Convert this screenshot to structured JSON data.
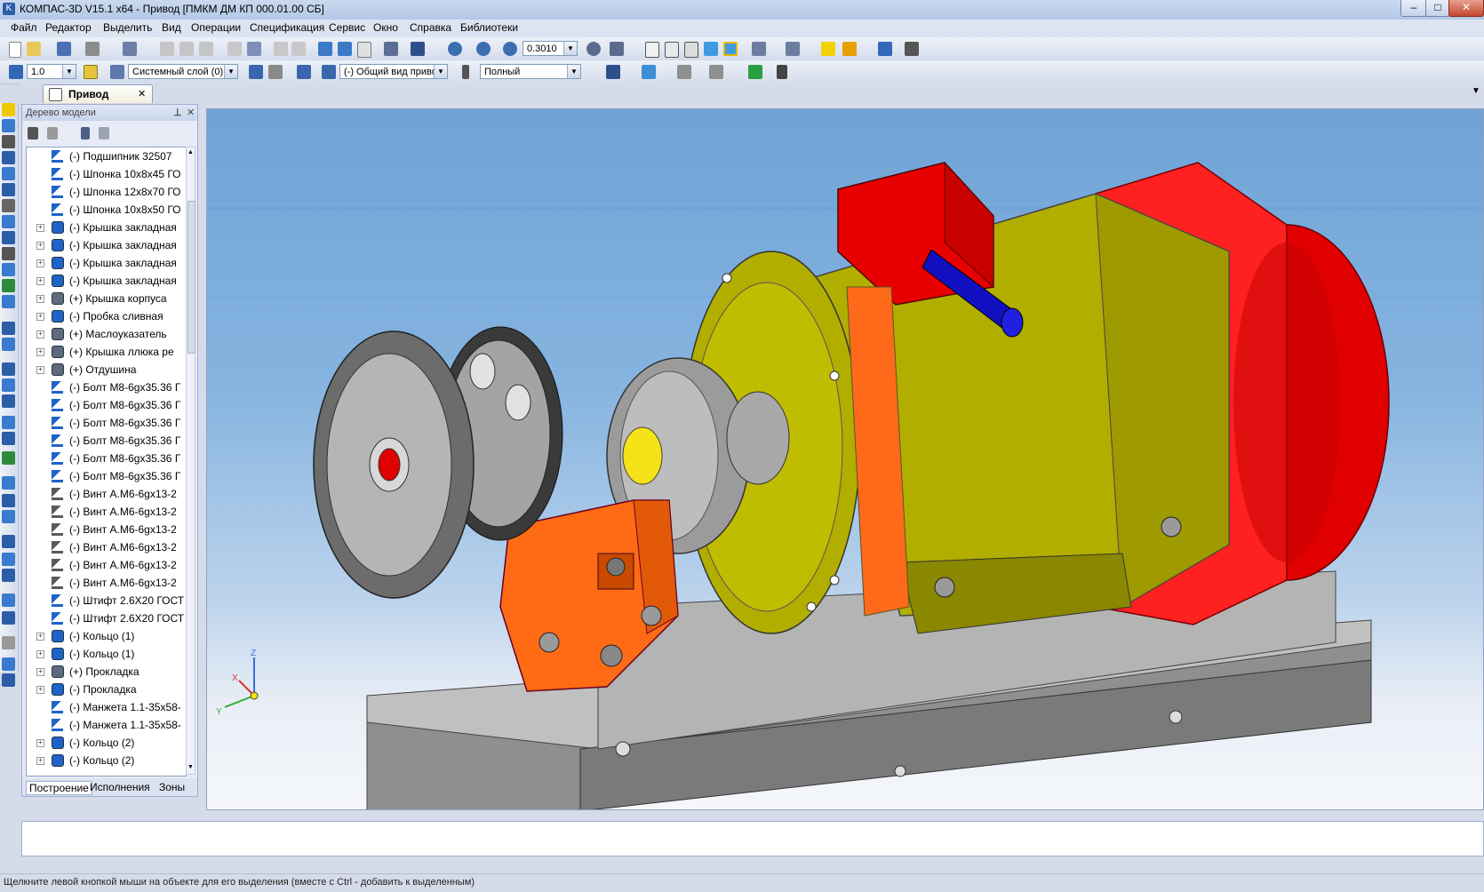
{
  "window": {
    "title": "КОМПАС-3D V15.1 x64 - Привод [ПМКМ ДМ КП 000.01.00 СБ]",
    "minimize": "–",
    "maximize": "□",
    "close": "✕"
  },
  "menu": {
    "items": [
      "Файл",
      "Редактор",
      "Выделить",
      "Вид",
      "Операции",
      "Спецификация",
      "Сервис",
      "Окно",
      "Справка",
      "Библиотеки"
    ]
  },
  "toolbar1": {
    "zoom_value": "0.3010"
  },
  "toolbar2": {
    "step_value": "1.0",
    "layer_value": "Системный слой (0)",
    "view_value": "(-) Общий вид приво",
    "render_value": "Полный"
  },
  "document_tab": {
    "label": "Привод",
    "close": "✕"
  },
  "model_tree": {
    "header": "Дерево модели",
    "pin": "⊥",
    "close": "✕",
    "items": [
      {
        "label": "(-) Подшипник 32507",
        "expandable": false,
        "icon": "part"
      },
      {
        "label": "(-) Шпонка 10x8x45 ГО",
        "expandable": false,
        "icon": "part"
      },
      {
        "label": "(-) Шпонка 12x8x70 ГО",
        "expandable": false,
        "icon": "part"
      },
      {
        "label": "(-) Шпонка 10x8x50 ГО",
        "expandable": false,
        "icon": "part"
      },
      {
        "label": "(-) Крышка закладная",
        "expandable": true,
        "icon": "assembly"
      },
      {
        "label": "(-) Крышка закладная",
        "expandable": true,
        "icon": "assembly"
      },
      {
        "label": "(-) Крышка закладная",
        "expandable": true,
        "icon": "assembly"
      },
      {
        "label": "(-) Крышка закладная",
        "expandable": true,
        "icon": "assembly"
      },
      {
        "label": "(+) Крышка корпуса",
        "expandable": true,
        "icon": "assembly-fixed"
      },
      {
        "label": "(-) Пробка сливная",
        "expandable": true,
        "icon": "assembly"
      },
      {
        "label": "(+) Маслоуказатель",
        "expandable": true,
        "icon": "assembly-fixed"
      },
      {
        "label": "(+) Крышка ллюка ре",
        "expandable": true,
        "icon": "assembly-fixed"
      },
      {
        "label": "(+) Отдушина",
        "expandable": true,
        "icon": "assembly-fixed"
      },
      {
        "label": "(-) Болт М8-6gx35.36 Г",
        "expandable": false,
        "icon": "part"
      },
      {
        "label": "(-) Болт М8-6gx35.36 Г",
        "expandable": false,
        "icon": "part"
      },
      {
        "label": "(-) Болт М8-6gx35.36 Г",
        "expandable": false,
        "icon": "part"
      },
      {
        "label": "(-) Болт М8-6gx35.36 Г",
        "expandable": false,
        "icon": "part"
      },
      {
        "label": "(-) Болт М8-6gx35.36 Г",
        "expandable": false,
        "icon": "part"
      },
      {
        "label": "(-) Болт М8-6gx35.36 Г",
        "expandable": false,
        "icon": "part"
      },
      {
        "label": "(-) Винт А.М6-6gx13-2",
        "expandable": false,
        "icon": "part-gray"
      },
      {
        "label": "(-) Винт А.М6-6gx13-2",
        "expandable": false,
        "icon": "part-gray"
      },
      {
        "label": "(-) Винт А.М6-6gx13-2",
        "expandable": false,
        "icon": "part-gray"
      },
      {
        "label": "(-) Винт А.М6-6gx13-2",
        "expandable": false,
        "icon": "part-gray"
      },
      {
        "label": "(-) Винт А.М6-6gx13-2",
        "expandable": false,
        "icon": "part-gray"
      },
      {
        "label": "(-) Винт А.М6-6gx13-2",
        "expandable": false,
        "icon": "part-gray"
      },
      {
        "label": "(-) Штифт 2.6X20 ГОСТ",
        "expandable": false,
        "icon": "part"
      },
      {
        "label": "(-) Штифт 2.6X20 ГОСТ",
        "expandable": false,
        "icon": "part"
      },
      {
        "label": "(-) Кольцо (1)",
        "expandable": true,
        "icon": "assembly"
      },
      {
        "label": "(-) Кольцо (1)",
        "expandable": true,
        "icon": "assembly"
      },
      {
        "label": "(+) Прокладка",
        "expandable": true,
        "icon": "assembly-fixed"
      },
      {
        "label": "(-) Прокладка",
        "expandable": true,
        "icon": "assembly"
      },
      {
        "label": "(-) Манжета 1.1-35x58-",
        "expandable": false,
        "icon": "part"
      },
      {
        "label": "(-) Манжета 1.1-35x58-",
        "expandable": false,
        "icon": "part"
      },
      {
        "label": "(-) Кольцо (2)",
        "expandable": true,
        "icon": "assembly"
      },
      {
        "label": "(-) Кольцо (2)",
        "expandable": true,
        "icon": "assembly"
      }
    ],
    "bottom_tabs": [
      "Построение",
      "Исполнения",
      "Зоны"
    ]
  },
  "triad": {
    "x": "X",
    "y": "Y",
    "z": "Z"
  },
  "status": {
    "hint": "Щелкните левой кнопкой мыши на объекте для его выделения (вместе с Ctrl - добавить к выделенным)"
  },
  "colors": {
    "motor_body": "#b7b300",
    "motor_fan": "#ff1a1a",
    "housing": "#ff6f1a",
    "shaft": "#1212c8",
    "steel": "#a9a9a9"
  }
}
